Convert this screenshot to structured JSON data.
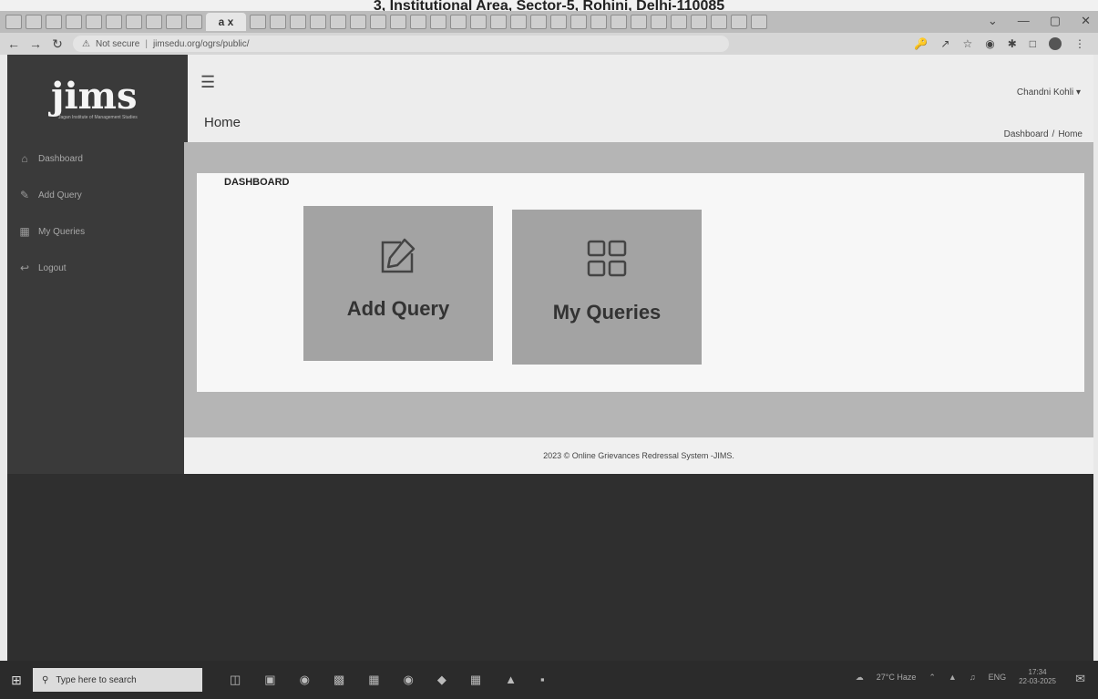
{
  "document": {
    "header_text": "3, Institutional Area, Sector-5, Rohini, Delhi-110085"
  },
  "browser": {
    "active_tab_label": "a x",
    "address": {
      "security_label": "Not secure",
      "url": "jimsedu.org/ogrs/public/"
    },
    "window_controls": [
      "⌄",
      "—",
      "▢",
      "✕"
    ]
  },
  "sidebar": {
    "logo_text": "jims",
    "logo_tagline": "Jagan Institute of Management Studies",
    "items": [
      {
        "label": "Dashboard",
        "icon": "home-icon"
      },
      {
        "label": "Add Query",
        "icon": "edit-icon"
      },
      {
        "label": "My Queries",
        "icon": "grid-icon"
      },
      {
        "label": "Logout",
        "icon": "logout-icon"
      }
    ]
  },
  "header": {
    "user_name": "Chandni Kohli",
    "page_title": "Home",
    "breadcrumb": {
      "first": "Dashboard",
      "separator": "/",
      "current": "Home"
    }
  },
  "dashboard": {
    "title": "DASHBOARD",
    "tiles": [
      {
        "label": "Add Query",
        "icon": "edit-icon"
      },
      {
        "label": "My Queries",
        "icon": "grid-icon"
      }
    ]
  },
  "footer": {
    "text": "2023 © Online Grievances Redressal System -JIMS."
  },
  "taskbar": {
    "search_placeholder": "Type here to search",
    "weather": "27°C Haze",
    "language": "ENG",
    "time": "17:34",
    "date": "22-03-2025"
  },
  "colors": {
    "sidebar_bg": "#3a3a3a",
    "tile_bg": "#a3a3a3",
    "panel_bg": "#f7f7f7"
  }
}
